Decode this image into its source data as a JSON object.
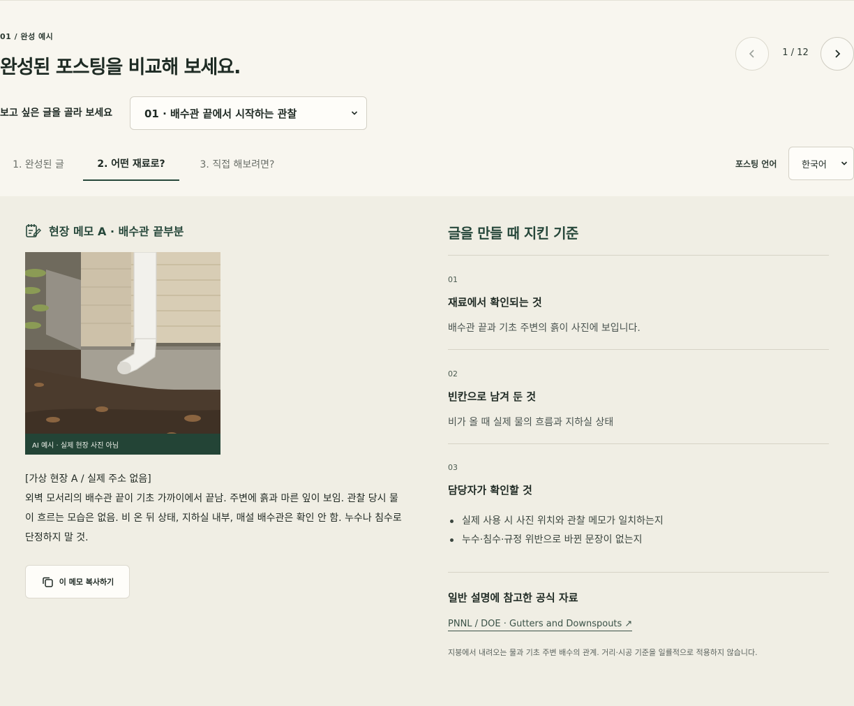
{
  "header": {
    "eyebrow": "01 / 완성 예시",
    "title": "완성된 포스팅을 비교해 보세요.",
    "pager": {
      "count": "1 / 12"
    }
  },
  "post_picker": {
    "label": "보고 싶은 글을 골라 보세요",
    "selected": "01 · 배수관 끝에서 시작하는 관찰"
  },
  "tabs": [
    {
      "label": "1. 완성된 글"
    },
    {
      "label": "2. 어떤 재료로?"
    },
    {
      "label": "3. 직접 해보려면?"
    }
  ],
  "language": {
    "label": "포스팅 언어",
    "selected": "한국어"
  },
  "memo": {
    "title": "현장 메모 A · 배수관 끝부분",
    "photo_caption": "AI 예시 · 실제 현장 사진 아님",
    "lines": [
      "[가상 현장 A / 실제 주소 없음]",
      "외벽 모서리의 배수관 끝이 기초 가까이에서 끝남. 주변에 흙과 마른 잎이 보임. 관찰 당시 물이 흐르는 모습은 없음. 비 온 뒤 상태, 지하실 내부, 매설 배수관은 확인 안 함. 누수나 침수로 단정하지 말 것."
    ],
    "copy_label": "이 메모 복사하기"
  },
  "criteria": {
    "title": "글을 만들 때 지킨 기준",
    "items": [
      {
        "num": "01",
        "heading": "재료에서 확인되는 것",
        "body": "배수관 끝과 기초 주변의 흙이 사진에 보입니다."
      },
      {
        "num": "02",
        "heading": "빈칸으로 남겨 둔 것",
        "body": "비가 올 때 실제 물의 흐름과 지하실 상태"
      },
      {
        "num": "03",
        "heading": "담당자가 확인할 것",
        "bullets": [
          "실제 사용 시 사진 위치와 관찰 메모가 일치하는지",
          "누수·침수·규정 위반으로 바뀐 문장이 없는지"
        ]
      }
    ]
  },
  "reference": {
    "title": "일반 설명에 참고한 공식 자료",
    "link": "PNNL / DOE · Gutters and Downspouts ↗",
    "note": "지붕에서 내려오는 물과 기초 주변 배수의 관계. 거리·시공 기준을 일률적으로 적용하지 않습니다."
  },
  "colors": {
    "accent": "#26473a",
    "panel": "#f0eee4",
    "background": "#f8f6ef"
  }
}
